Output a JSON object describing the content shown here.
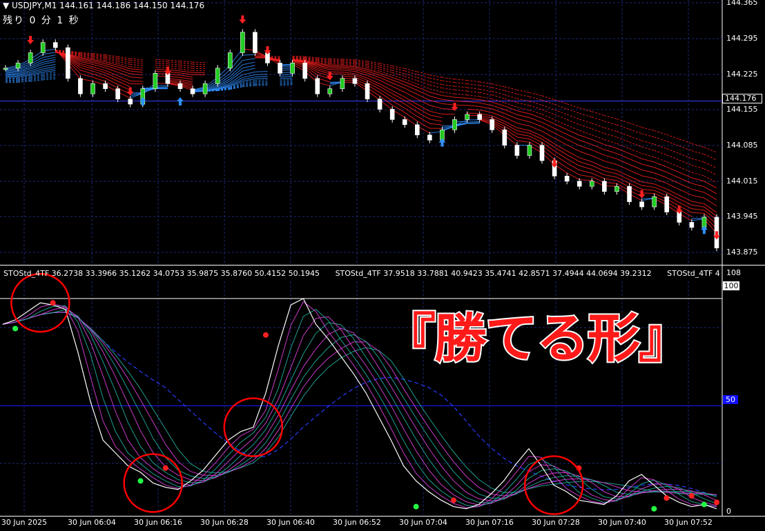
{
  "header": {
    "symbol_text": "▼ USDJPY,M1  144.161 144.186 144.150 144.176",
    "remaining_text": "残り 0 分 1 秒"
  },
  "price_axis": {
    "labels": [
      "144.365",
      "144.295",
      "144.225",
      "144.176",
      "144.155",
      "144.085",
      "144.015",
      "143.945",
      "143.875"
    ],
    "current_price": "144.176"
  },
  "sub_axis": {
    "top_label": "108",
    "level_100": "100",
    "level_50": "50",
    "bottom_label": "0"
  },
  "indicator": {
    "readouts": [
      "STOStd_4TF 36.2738 33.3966 35.1262 34.0753 35.9875 35.8760 50.4152 50.1945",
      "STOStd_4TF 37.9518 33.7881 40.9423 35.4741 42.8571 37.4944 44.0694 39.2312",
      "STOStd_4TF 4"
    ]
  },
  "overlay": {
    "text": "『勝てる形』"
  },
  "time_axis": {
    "labels": [
      "30 Jun 2025",
      "30 Jun 06:04",
      "30 Jun 06:16",
      "30 Jun 06:28",
      "30 Jun 06:40",
      "30 Jun 06:52",
      "30 Jun 07:04",
      "30 Jun 07:16",
      "30 Jun 07:28",
      "30 Jun 07:40",
      "30 Jun 07:52"
    ]
  },
  "chart_data": {
    "type": "line",
    "price_panel": {
      "ylim": [
        143.86,
        144.37
      ],
      "x": [
        "06:00",
        "06:02",
        "06:04",
        "06:06",
        "06:08",
        "06:10",
        "06:12",
        "06:14",
        "06:16",
        "06:18",
        "06:20",
        "06:22",
        "06:24",
        "06:26",
        "06:28",
        "06:30",
        "06:32",
        "06:34",
        "06:36",
        "06:38",
        "06:40",
        "06:42",
        "06:44",
        "06:46",
        "06:48",
        "06:50",
        "06:52",
        "06:54",
        "06:56",
        "06:58",
        "07:00",
        "07:02",
        "07:04",
        "07:06",
        "07:08",
        "07:10",
        "07:12",
        "07:14",
        "07:16",
        "07:18",
        "07:20",
        "07:22",
        "07:24",
        "07:26",
        "07:28",
        "07:30",
        "07:32",
        "07:34",
        "07:36",
        "07:38",
        "07:40",
        "07:42",
        "07:44",
        "07:46",
        "07:48",
        "07:50",
        "07:52",
        "07:54"
      ],
      "close": [
        144.24,
        144.25,
        144.27,
        144.29,
        144.28,
        144.22,
        144.19,
        144.21,
        144.2,
        144.18,
        144.17,
        144.2,
        144.23,
        144.21,
        144.2,
        144.19,
        144.21,
        144.24,
        144.27,
        144.31,
        144.27,
        144.25,
        144.23,
        144.25,
        144.22,
        144.19,
        144.2,
        144.22,
        144.21,
        144.18,
        144.16,
        144.14,
        144.13,
        144.11,
        144.1,
        144.12,
        144.14,
        144.15,
        144.14,
        144.12,
        144.09,
        144.07,
        144.09,
        144.06,
        144.03,
        144.02,
        144.01,
        144.02,
        144.0,
        144.01,
        143.98,
        143.97,
        143.99,
        143.96,
        143.94,
        143.93,
        143.95,
        143.89
      ],
      "signals": [
        {
          "type": "sell-arrow",
          "x": "06:04"
        },
        {
          "type": "sell-arrow",
          "x": "06:20"
        },
        {
          "type": "buy-arrow",
          "x": "06:22"
        },
        {
          "type": "sell-arrow",
          "x": "06:26"
        },
        {
          "type": "buy-arrow",
          "x": "06:28"
        },
        {
          "type": "sell-arrow",
          "x": "06:38"
        },
        {
          "type": "sell-arrow",
          "x": "06:42"
        },
        {
          "type": "sell-arrow",
          "x": "06:52"
        },
        {
          "type": "buy-arrow",
          "x": "07:10"
        },
        {
          "type": "sell-arrow",
          "x": "07:12"
        },
        {
          "type": "sell-arrow",
          "x": "07:28"
        },
        {
          "type": "sell-arrow",
          "x": "07:42"
        },
        {
          "type": "sell-arrow",
          "x": "07:48"
        },
        {
          "type": "buy-arrow",
          "x": "07:52"
        },
        {
          "type": "sell-arrow",
          "x": "07:54"
        }
      ]
    },
    "stochastic_panel": {
      "ylim": [
        0,
        108
      ],
      "levels": [
        50,
        100
      ],
      "x": [
        "06:00",
        "06:02",
        "06:04",
        "06:06",
        "06:08",
        "06:10",
        "06:12",
        "06:14",
        "06:16",
        "06:18",
        "06:20",
        "06:22",
        "06:24",
        "06:26",
        "06:28",
        "06:30",
        "06:32",
        "06:34",
        "06:36",
        "06:38",
        "06:40",
        "06:42",
        "06:44",
        "06:46",
        "06:48",
        "06:50",
        "06:52",
        "06:54",
        "06:56",
        "06:58",
        "07:00",
        "07:02",
        "07:04",
        "07:06",
        "07:08",
        "07:10",
        "07:12",
        "07:14",
        "07:16",
        "07:18",
        "07:20",
        "07:22",
        "07:24",
        "07:26",
        "07:28",
        "07:30",
        "07:32",
        "07:34",
        "07:36",
        "07:38",
        "07:40",
        "07:42",
        "07:44",
        "07:46",
        "07:48",
        "07:50",
        "07:52",
        "07:54"
      ],
      "main_line": [
        88,
        90,
        94,
        98,
        97,
        95,
        75,
        52,
        34,
        28,
        22,
        19,
        14,
        12,
        11,
        15,
        20,
        27,
        34,
        38,
        40,
        56,
        78,
        97,
        100,
        88,
        81,
        73,
        65,
        56,
        45,
        34,
        22,
        15,
        10,
        6,
        3,
        2,
        4,
        9,
        15,
        23,
        30,
        22,
        13,
        10,
        6,
        5,
        4,
        8,
        15,
        18,
        13,
        8,
        5,
        3,
        4,
        2
      ],
      "ribbon_lines": 8,
      "dots": [
        {
          "color": "green",
          "x": "06:02",
          "y": 86
        },
        {
          "color": "red",
          "x": "06:08",
          "y": 98
        },
        {
          "color": "green",
          "x": "06:22",
          "y": 15
        },
        {
          "color": "red",
          "x": "06:26",
          "y": 21
        },
        {
          "color": "red",
          "x": "06:42",
          "y": 83
        },
        {
          "color": "green",
          "x": "07:06",
          "y": 3
        },
        {
          "color": "red",
          "x": "07:12",
          "y": 6
        },
        {
          "color": "red",
          "x": "07:32",
          "y": 21
        },
        {
          "color": "green",
          "x": "07:44",
          "y": 2
        },
        {
          "color": "red",
          "x": "07:46",
          "y": 7
        },
        {
          "color": "red",
          "x": "07:50",
          "y": 8
        },
        {
          "color": "green",
          "x": "07:52",
          "y": 4
        },
        {
          "color": "red",
          "x": "07:54",
          "y": 5
        }
      ],
      "highlight_circles": [
        "06:06",
        "06:24",
        "06:40",
        "07:28"
      ]
    }
  },
  "colors": {
    "background": "#000000",
    "grid": "#1e2a78",
    "candle_up": "#22cc22",
    "candle_down": "#ffffff",
    "ma_bear": "#ff2020",
    "ma_bull": "#3090ff",
    "stoch_main": "#ffffff",
    "ribbon_a": "#e040e0",
    "ribbon_b": "#20b0a0",
    "highlight": "#ff0000",
    "level_line": "#1a1aff",
    "overlay_text": "#ff1a1a"
  }
}
